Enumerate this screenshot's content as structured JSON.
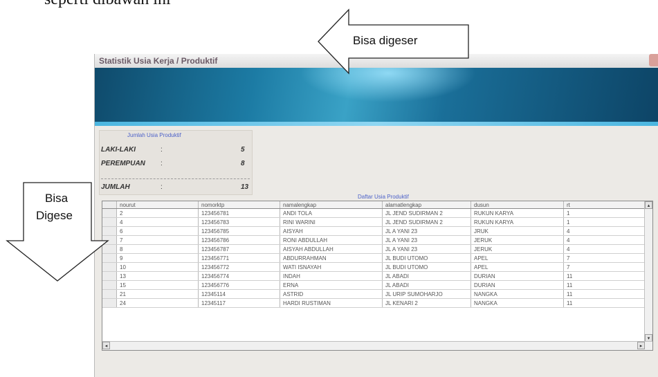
{
  "document": {
    "heading": "seperti dibawah ini"
  },
  "window": {
    "title": "Statistik Usia Kerja / Produktif",
    "summary": {
      "title": "Jumlah Usia Produktif",
      "rows": [
        {
          "label": "LAKI-LAKI",
          "colon": ":",
          "value": "5"
        },
        {
          "label": "PEREMPUAN",
          "colon": ":",
          "value": "8"
        },
        {
          "label": "JUMLAH",
          "colon": ":",
          "value": "13"
        }
      ]
    },
    "table_caption": "Daftar Usia Produktif",
    "table": {
      "columns": [
        "nourut",
        "nomorktp",
        "namalengkap",
        "alamatlengkap",
        "dusun",
        "rt"
      ],
      "rows": [
        [
          "2",
          "123456781",
          "ANDI TOLA",
          "JL JEND SUDIRMAN 2",
          "RUKUN KARYA",
          "1"
        ],
        [
          "4",
          "123456783",
          "RINI WARINI",
          "JL JEND SUDIRMAN 2",
          "RUKUN KARYA",
          "1"
        ],
        [
          "6",
          "123456785",
          "AISYAH",
          "JL A YANI 23",
          "JRUK",
          "4"
        ],
        [
          "7",
          "123456786",
          "RONI ABDULLAH",
          "JL A YANI 23",
          "JERUK",
          "4"
        ],
        [
          "8",
          "123456787",
          "AISYAH ABDULLAH",
          "JL A YANI 23",
          "JERUK",
          "4"
        ],
        [
          "9",
          "123456771",
          "ABDURRAHMAN",
          "JL BUDI UTOMO",
          "APEL",
          "7"
        ],
        [
          "10",
          "123456772",
          "WATI ISNAYAH",
          "JL BUDI UTOMO",
          "APEL",
          "7"
        ],
        [
          "13",
          "123456774",
          "INDAH",
          "JL ABADI",
          "DURIAN",
          "11"
        ],
        [
          "15",
          "123456776",
          "ERNA",
          "JL ABADI",
          "DURIAN",
          "11"
        ],
        [
          "21",
          "12345114",
          "ASTRID",
          "JL URIP SUMOHARJO",
          "NANGKA",
          "11"
        ],
        [
          "24",
          "12345117",
          "HARDI RUSTIMAN",
          "JL KENARI 2",
          "NANGKA",
          "11"
        ]
      ]
    }
  },
  "callouts": {
    "top": "Bisa digeser",
    "left_line1": "Bisa",
    "left_line2": "Digese"
  },
  "colors": {
    "caption_blue": "#4d62c9",
    "banner": "#1c7ba4"
  },
  "icons": {
    "scroll_left": "◂",
    "scroll_right": "▸",
    "scroll_up": "▴",
    "scroll_down": "▾"
  }
}
